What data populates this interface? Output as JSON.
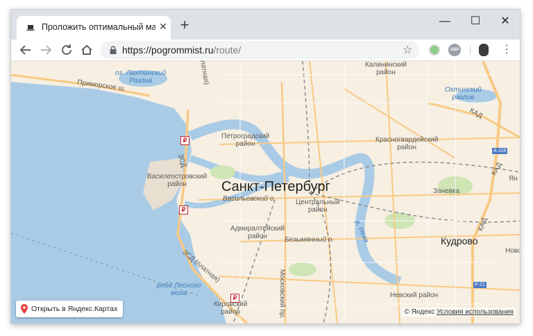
{
  "browser": {
    "tab_title": "Проложить оптимальный марш",
    "tab_close": "✕",
    "new_tab": "+",
    "minimize": "—",
    "maximize": "☐",
    "close": "✕",
    "url_host": "https://pogrommist.ru",
    "url_path": "/route/",
    "ext_abp": "ABP"
  },
  "map": {
    "labels": {
      "lakhta": "оз. Лахтинский\nРазлив",
      "primorskoe": "Приморское ш.",
      "kalininsky": "Калининский\nрайон",
      "okhtinsky": "Охтинский\nразлив",
      "petrogradsky": "Петроградский\nрайон",
      "krasnogvardeysky": "Красногвардейский\nрайон",
      "vasileostrovsky": "Василеостровский\nрайон",
      "spb": "Санкт-Петербург",
      "vasilyevsky_o": "Васильевский о.",
      "tsentralny": "Центральный\nрайон",
      "zanevka": "Заневка",
      "admiralteysky": "Адмиралтейский\nрайон",
      "bezymyanny": "Безымянный о.",
      "neva": "р. Нева",
      "kudrovo": "Кудрово",
      "novo": "Ново",
      "yan": "Ян",
      "zsd": "ЗСД",
      "zsd_platnaya": "ЗСД (платная)",
      "platnaya_top": "Д (платная)",
      "kad": "КАД",
      "a118": "А-118",
      "r21": "Р-21",
      "lesnoy": "рейд Лесного\nмола",
      "kirovsky": "Кировский\nрайон",
      "moskovsky": "Московский пр.",
      "nevsky": "Невский район",
      "ruble": "₽"
    },
    "open_button": "Открыть в Яндекс.Картах",
    "copyright_prefix": "© Яндекс",
    "copyright_terms": "Условия использования"
  },
  "colors": {
    "water": "#a9cbe6",
    "land": "#f6efe2",
    "road": "#f9c983",
    "park": "#cfe5b5"
  }
}
